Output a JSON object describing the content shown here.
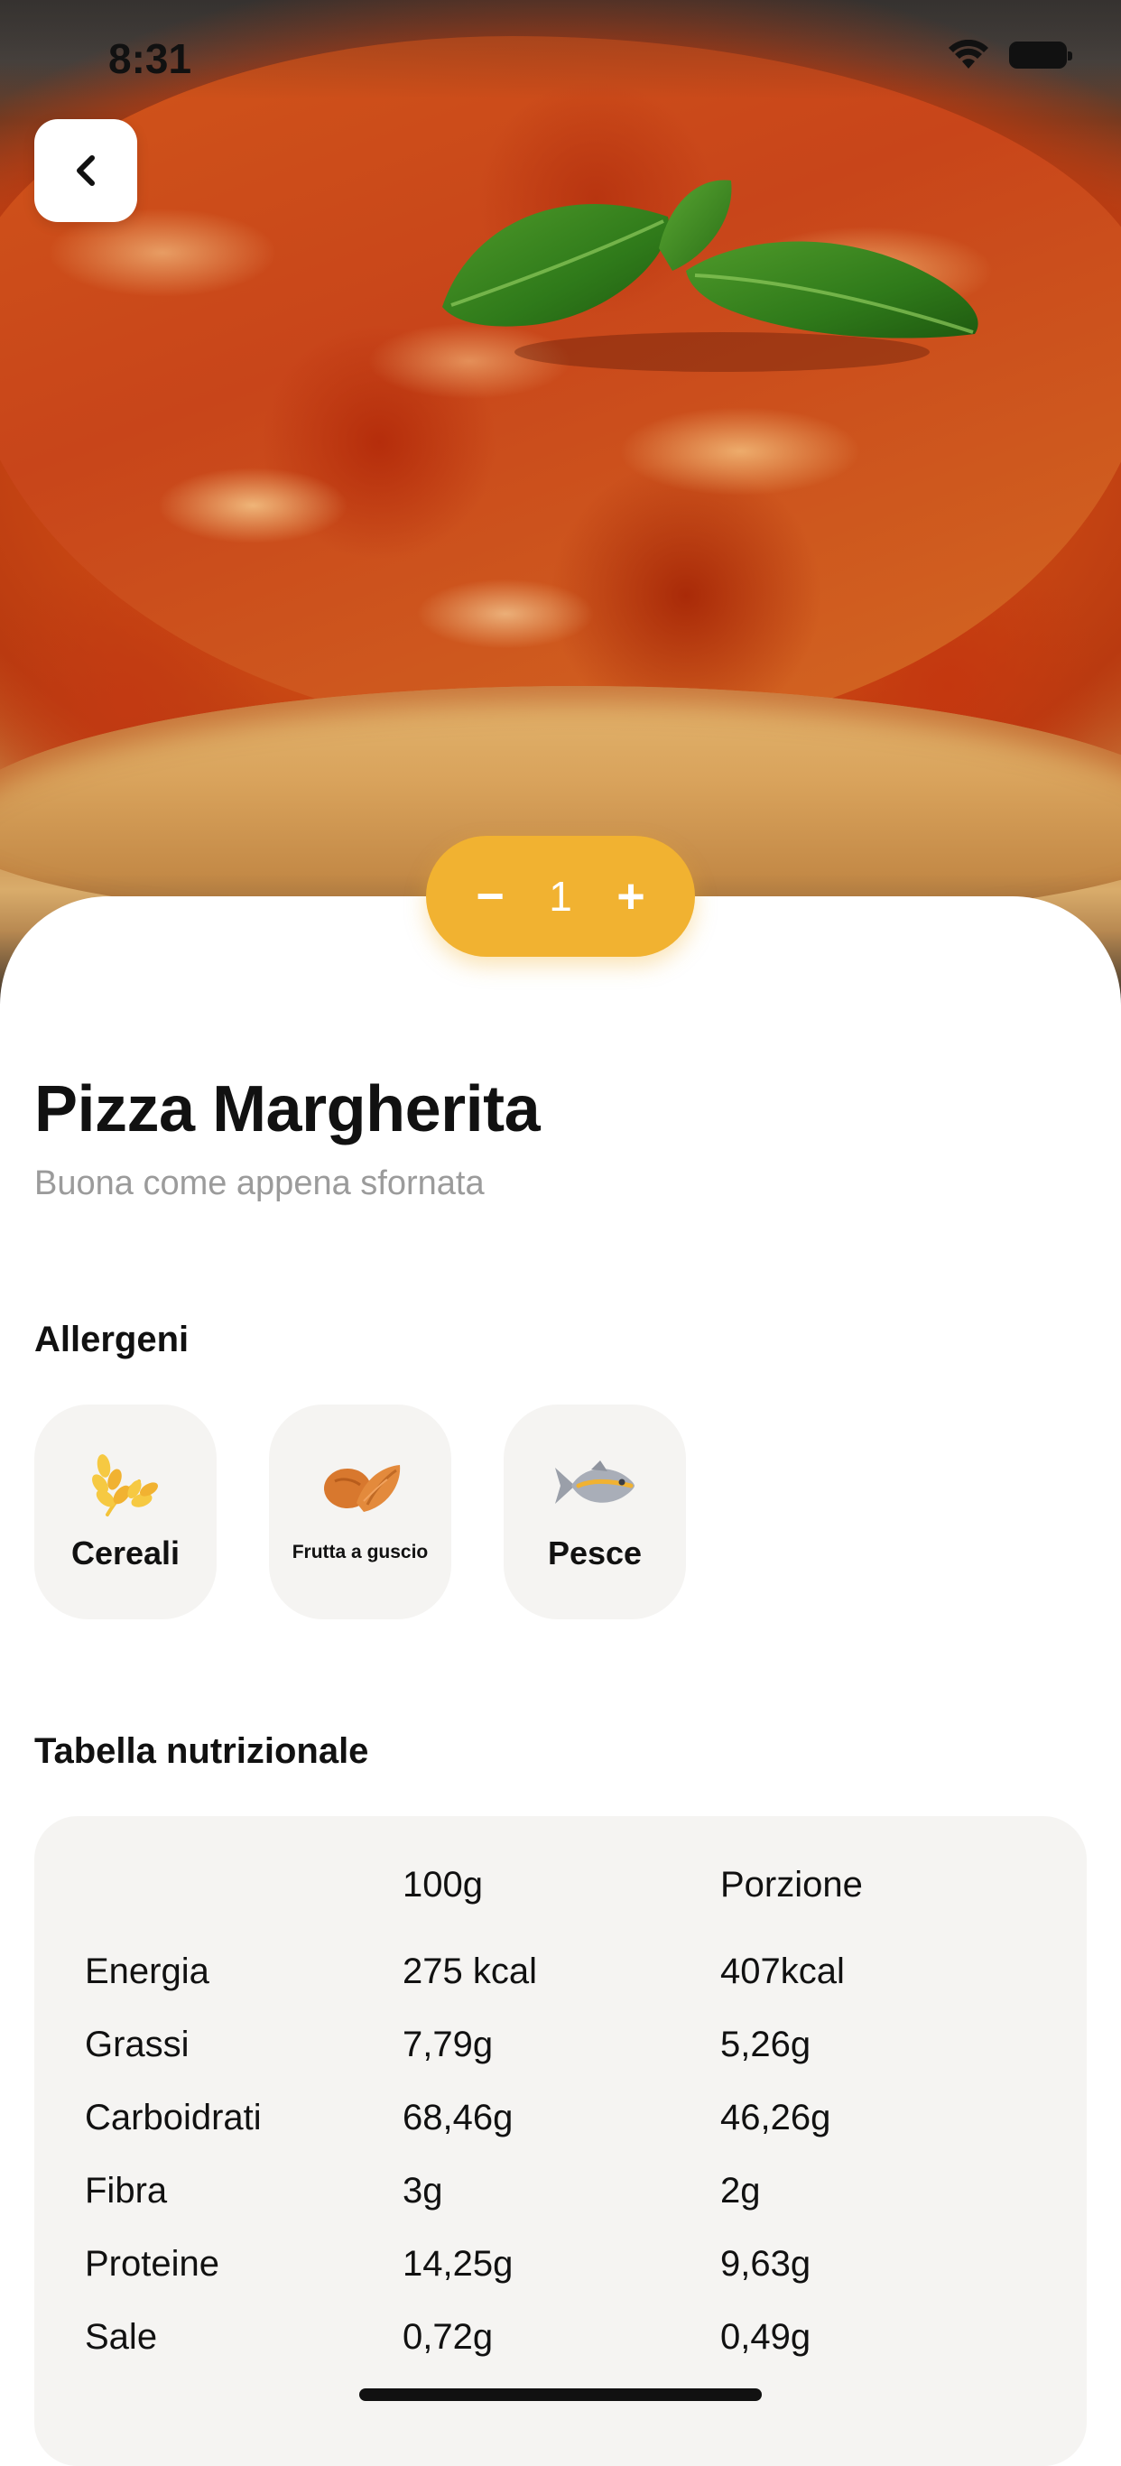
{
  "status_bar": {
    "time": "8:31",
    "wifi_icon": "wifi-icon",
    "battery_icon": "battery-icon"
  },
  "nav": {
    "back_icon": "chevron-left-icon"
  },
  "hero": {
    "image": "pizza-margherita-photo"
  },
  "quantity": {
    "minus": "−",
    "value": "1",
    "plus": "+"
  },
  "product": {
    "title": "Pizza Margherita",
    "subtitle": "Buona come appena sfornata"
  },
  "allergens": {
    "heading": "Allergeni",
    "items": [
      {
        "label": "Cereali",
        "icon": "wheat-icon"
      },
      {
        "label": "Frutta a guscio",
        "icon": "almond-icon"
      },
      {
        "label": "Pesce",
        "icon": "fish-icon"
      }
    ]
  },
  "nutrition": {
    "heading": "Tabella nutrizionale",
    "columns": [
      "",
      "100g",
      "Porzione"
    ],
    "rows": [
      [
        "Energia",
        "275 kcal",
        "407kcal"
      ],
      [
        "Grassi",
        "7,79g",
        "5,26g"
      ],
      [
        "Carboidrati",
        "68,46g",
        "46,26g"
      ],
      [
        "Fibra",
        "3g",
        "2g"
      ],
      [
        "Proteine",
        "14,25g",
        "9,63g"
      ],
      [
        "Sale",
        "0,72g",
        "0,49g"
      ]
    ]
  },
  "colors": {
    "accent": "#f1b231",
    "card_bg": "#f5f4f2",
    "muted_text": "#9b9b9b"
  }
}
